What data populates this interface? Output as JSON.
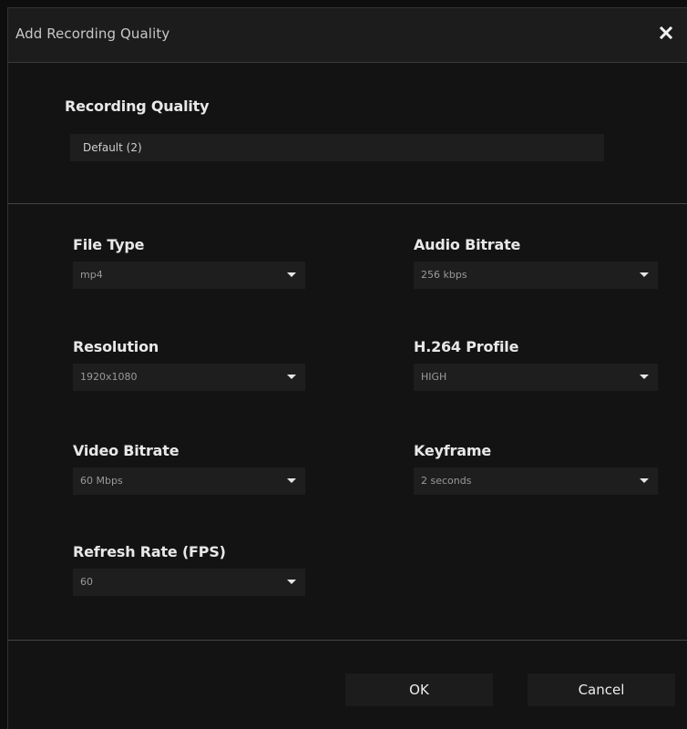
{
  "dialog": {
    "title": "Add Recording Quality",
    "close_icon": "close-icon"
  },
  "quality": {
    "label": "Recording Quality",
    "value": "Default (2)"
  },
  "fields": {
    "file_type": {
      "label": "File Type",
      "value": "mp4"
    },
    "audio_bitrate": {
      "label": "Audio Bitrate",
      "value": "256 kbps"
    },
    "resolution": {
      "label": "Resolution",
      "value": "1920x1080"
    },
    "h264_profile": {
      "label": "H.264 Profile",
      "value": "HIGH"
    },
    "video_bitrate": {
      "label": "Video Bitrate",
      "value": "60 Mbps"
    },
    "keyframe": {
      "label": "Keyframe",
      "value": "2 seconds"
    },
    "refresh_rate": {
      "label": "Refresh Rate (FPS)",
      "value": "60"
    }
  },
  "buttons": {
    "ok": "OK",
    "cancel": "Cancel"
  },
  "colors": {
    "background": "#131313",
    "field": "#1e1e1e",
    "text": "#e8e8e8"
  }
}
